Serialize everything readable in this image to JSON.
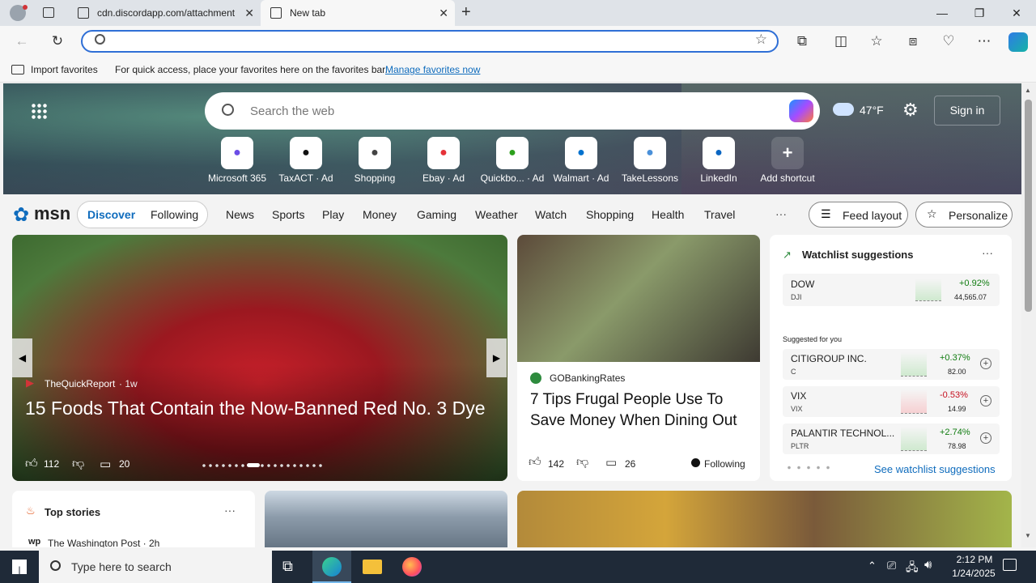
{
  "browser": {
    "tabs": [
      {
        "label": "cdn.discordapp.com/attachment"
      },
      {
        "label": "New tab"
      }
    ],
    "address": {
      "value": "",
      "placeholder": ""
    },
    "favorites_bar": {
      "import_label": "Import favorites",
      "hint": "For quick access, place your favorites here on the favorites bar.",
      "manage_link": "Manage favorites now"
    }
  },
  "page": {
    "search_placeholder": "Search the web",
    "weather": "47°F",
    "sign_in": "Sign in",
    "shortcuts": [
      {
        "label": "Microsoft 365",
        "icon": "microsoft365-icon"
      },
      {
        "label": "TaxACT · Ad",
        "icon": "taxact-icon"
      },
      {
        "label": "Shopping",
        "icon": "shopping-tag-icon"
      },
      {
        "label": "Ebay · Ad",
        "icon": "ebay-icon"
      },
      {
        "label": "Quickbo... · Ad",
        "icon": "quickbooks-icon"
      },
      {
        "label": "Walmart · Ad",
        "icon": "walmart-icon"
      },
      {
        "label": "TakeLessons",
        "icon": "takelessons-icon"
      },
      {
        "label": "LinkedIn",
        "icon": "linkedin-icon"
      },
      {
        "label": "Add shortcut",
        "icon": "plus-icon"
      }
    ],
    "brand": "msn",
    "feed_tabs": [
      "Discover",
      "Following"
    ],
    "nav_items": [
      "News",
      "Sports",
      "Play",
      "Money",
      "Gaming",
      "Weather",
      "Watch",
      "Shopping",
      "Health",
      "Travel"
    ],
    "more": "···",
    "feed_layout": "Feed layout",
    "personalize": "Personalize",
    "hero_story": {
      "source": "TheQuickReport",
      "age": "· 1w",
      "title": "15 Foods That Contain the Now-Banned Red No. 3 Dye",
      "likes": "112",
      "comments": "20"
    },
    "story2": {
      "source": "GOBankingRates",
      "title": "7 Tips Frugal People Use To Save Money When Dining Out",
      "likes": "142",
      "comments": "26",
      "following": "Following"
    },
    "watchlist": {
      "title": "Watchlist suggestions",
      "main": {
        "name": "DOW",
        "ticker": "DJI",
        "change": "+0.92%",
        "price": "44,565.07"
      },
      "suggested_label": "Suggested for you",
      "items": [
        {
          "name": "CITIGROUP INC.",
          "ticker": "C",
          "change": "+0.37%",
          "price": "82.00"
        },
        {
          "name": "VIX",
          "ticker": "VIX",
          "change": "-0.53%",
          "price": "14.99"
        },
        {
          "name": "PALANTIR TECHNOL...",
          "ticker": "PLTR",
          "change": "+2.74%",
          "price": "78.98"
        }
      ],
      "see_more": "See watchlist suggestions"
    },
    "top_stories": {
      "title": "Top stories",
      "source": "The Washington Post · 2h"
    }
  },
  "taskbar": {
    "search_placeholder": "Type here to search",
    "time": "2:12 PM",
    "date": "1/24/2025"
  },
  "colors": {
    "accent": "#0f6cbd",
    "positive": "#107c10",
    "negative": "#c50f1f"
  }
}
